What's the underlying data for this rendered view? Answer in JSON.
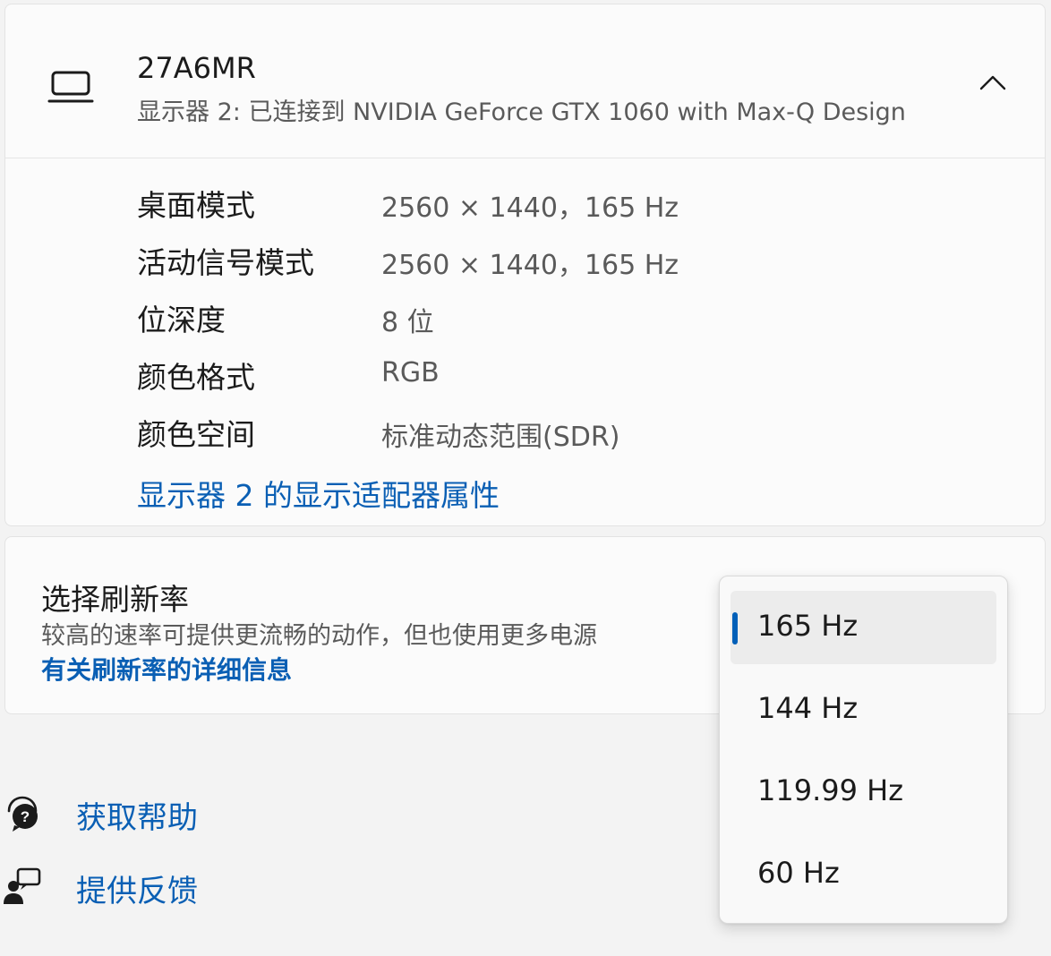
{
  "display": {
    "name": "27A6MR",
    "description": "显示器 2: 已连接到 NVIDIA GeForce GTX 1060 with Max-Q Design",
    "monitor_icon": "laptop-monitor-icon",
    "collapse_icon": "chevron-up-icon",
    "properties": [
      {
        "label": "桌面模式",
        "value": "2560 × 1440，165 Hz"
      },
      {
        "label": "活动信号模式",
        "value": "2560 × 1440，165 Hz"
      },
      {
        "label": "位深度",
        "value": "8 位"
      },
      {
        "label": "颜色格式",
        "value": "RGB"
      },
      {
        "label": "颜色空间",
        "value": "标准动态范围(SDR)"
      }
    ],
    "adapter_link": "显示器 2 的显示适配器属性"
  },
  "refresh_rate": {
    "title": "选择刷新率",
    "description": "较高的速率可提供更流畅的动作，但也使用更多电源",
    "more_info_link": "有关刷新率的详细信息",
    "selected": "165 Hz",
    "options": [
      "165 Hz",
      "144 Hz",
      "119.99 Hz",
      "60 Hz"
    ]
  },
  "footer": {
    "help_label": "获取帮助",
    "help_icon": "help-chat-icon",
    "feedback_label": "提供反馈",
    "feedback_icon": "feedback-person-icon"
  },
  "colors": {
    "accent": "#005fb8",
    "link": "#0a5fb4",
    "background": "#f3f3f3",
    "card": "#fbfbfb"
  }
}
